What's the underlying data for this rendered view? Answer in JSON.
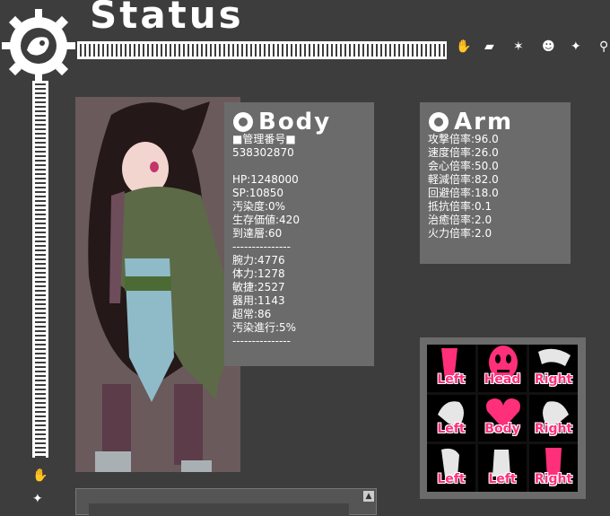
{
  "header": {
    "title": "Status",
    "icons": [
      "hand-icon",
      "bottle-icon",
      "creature-icon",
      "face-icon",
      "figure-icon",
      "figure-small-icon"
    ]
  },
  "body_panel": {
    "title": "Body",
    "id_label": "■管理番号■",
    "id_value": "538302870",
    "hp": "HP:1248000",
    "sp": "SP:10850",
    "contamination": "汚染度:0%",
    "survival": "生存価値:420",
    "reached_floor": "到達層:60",
    "separator": "---------------",
    "strength": "腕力:4776",
    "stamina": "体力:1278",
    "agility": "敏捷:2527",
    "dexterity": "器用:1143",
    "paranormal": "超常:86",
    "contamination_progress": "汚染進行:5%",
    "separator2": "---------------"
  },
  "arm_panel": {
    "title": "Arm",
    "attack": "攻撃倍率:96.0",
    "speed": "速度倍率:26.0",
    "critical": "会心倍率:50.0",
    "reduction": "軽減倍率:82.0",
    "evasion": "回避倍率:18.0",
    "resistance": "抵抗倍率:0.1",
    "healing": "治癒倍率:2.0",
    "firepower": "火力倍率:2.0"
  },
  "body_parts": [
    {
      "label": "Left",
      "icon": "arm-icon"
    },
    {
      "label": "Head",
      "icon": "head-icon"
    },
    {
      "label": "Right",
      "icon": "arm-icon"
    },
    {
      "label": "Left",
      "icon": "arm-icon"
    },
    {
      "label": "Body",
      "icon": "heart-icon"
    },
    {
      "label": "Right",
      "icon": "arm-icon"
    },
    {
      "label": "Left",
      "icon": "leg-icon"
    },
    {
      "label": "Left",
      "icon": "leg-icon"
    },
    {
      "label": "Right",
      "icon": "leg-icon"
    }
  ],
  "colors": {
    "background": "#3d3d3d",
    "panel": "#6b6b6b",
    "accent": "#ff2f7a"
  }
}
